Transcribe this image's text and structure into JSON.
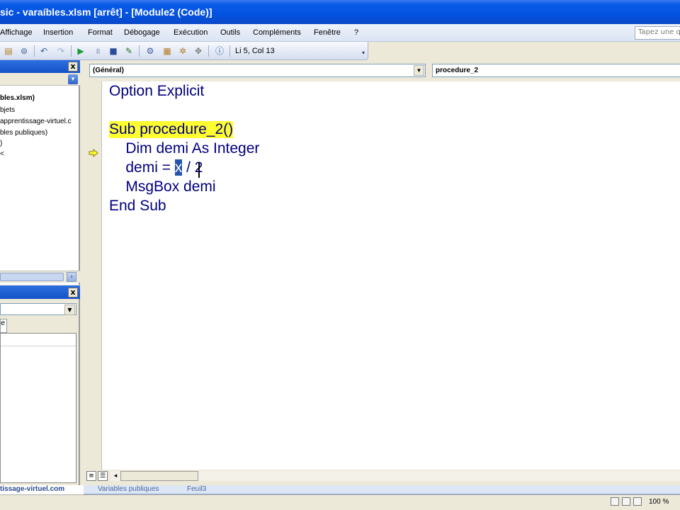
{
  "window": {
    "title": "sic - varaíbles.xlsm [arrêt] - [Module2 (Code)]"
  },
  "menu": {
    "items": [
      "Affichage",
      "Insertion",
      "Format",
      "Débogage",
      "Exécution",
      "Outils",
      "Compléments",
      "Fenêtre",
      "?"
    ],
    "help_placeholder": "Tapez une q"
  },
  "toolbar": {
    "cursor_position": "Li 5, Col 13"
  },
  "project_explorer": {
    "close_label": "x",
    "tree": [
      "bles.xlsm)",
      "bjets",
      "apprentissage-virtuel.c",
      "bles publiques)",
      ")",
      "<"
    ]
  },
  "properties": {
    "close_label": "x",
    "tab_label": "e"
  },
  "code_window": {
    "object_combo": "(Général)",
    "procedure_combo": "procedure_2",
    "lines": {
      "l1": "Option Explicit",
      "l2": "Sub procedure_2()",
      "l3": "    Dim demi As Integer",
      "l4_pre": "    demi = ",
      "l4_sel": "x",
      "l4_post": " / 2",
      "l5": "    MsgBox demi",
      "l6": "End Sub"
    }
  },
  "sheet_tabs": {
    "tabs": [
      "tissage-virtuel.com",
      "Variables publiques",
      "Feuil3"
    ]
  },
  "status": {
    "zoom": "100 %"
  },
  "colors": {
    "titlebar": "#0452e0",
    "code_keyword": "#00007f",
    "exec_highlight": "#ffff30",
    "selection": "#2654a8"
  }
}
